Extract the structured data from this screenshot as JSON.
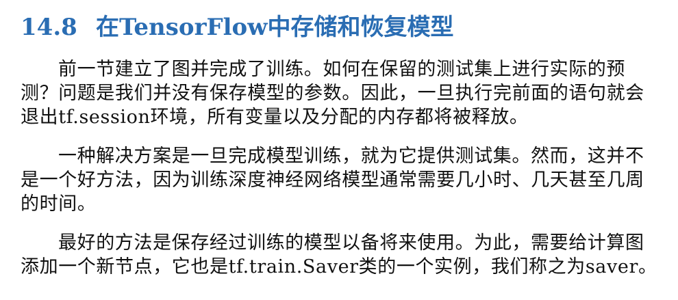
{
  "section": {
    "number": "14.8",
    "title": "在TensorFlow中存储和恢复模型"
  },
  "paragraphs": [
    "前一节建立了图并完成了训练。如何在保留的测试集上进行实际的预测？问题是我们并没有保存模型的参数。因此，一旦执行完前面的语句就会退出tf.session环境，所有变量以及分配的内存都将被释放。",
    "一种解决方案是一旦完成模型训练，就为它提供测试集。然而，这并不是一个好方法，因为训练深度神经网络模型通常需要几小时、几天甚至几周的时间。",
    "最好的方法是保存经过训练的模型以备将来使用。为此，需要给计算图添加一个新节点，它也是tf.train.Saver类的一个实例，我们称之为saver。"
  ],
  "colors": {
    "heading": "#2a6db3",
    "body_text": "#111111"
  }
}
